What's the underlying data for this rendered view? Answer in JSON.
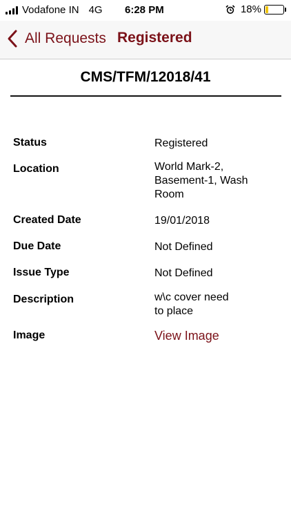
{
  "status_bar": {
    "carrier": "Vodafone IN",
    "network": "4G",
    "time": "6:28 PM",
    "battery": "18%",
    "battery_level": 0.18,
    "icons": [
      "signal-icon",
      "alarm-icon",
      "battery-icon"
    ]
  },
  "nav": {
    "back_label": "All Requests",
    "title": "Registered",
    "accent_color": "#7b1219"
  },
  "request": {
    "id": "CMS/TFM/12018/41"
  },
  "details": {
    "status_label": "Status",
    "status_value": "Registered",
    "location_label": "Location",
    "location_value_1": "World Mark-2,",
    "location_value_2": "Basement-1, Wash",
    "location_value_3": "Room",
    "created_label": "Created  Date",
    "created_value": "19/01/2018",
    "due_label": "Due Date",
    "due_value": "Not Defined",
    "issue_label": "Issue Type",
    "issue_value": "Not Defined",
    "description_label": "Description",
    "description_value_1": "w\\c cover need",
    "description_value_2": "to place",
    "image_label": "Image",
    "image_link": "View Image"
  }
}
